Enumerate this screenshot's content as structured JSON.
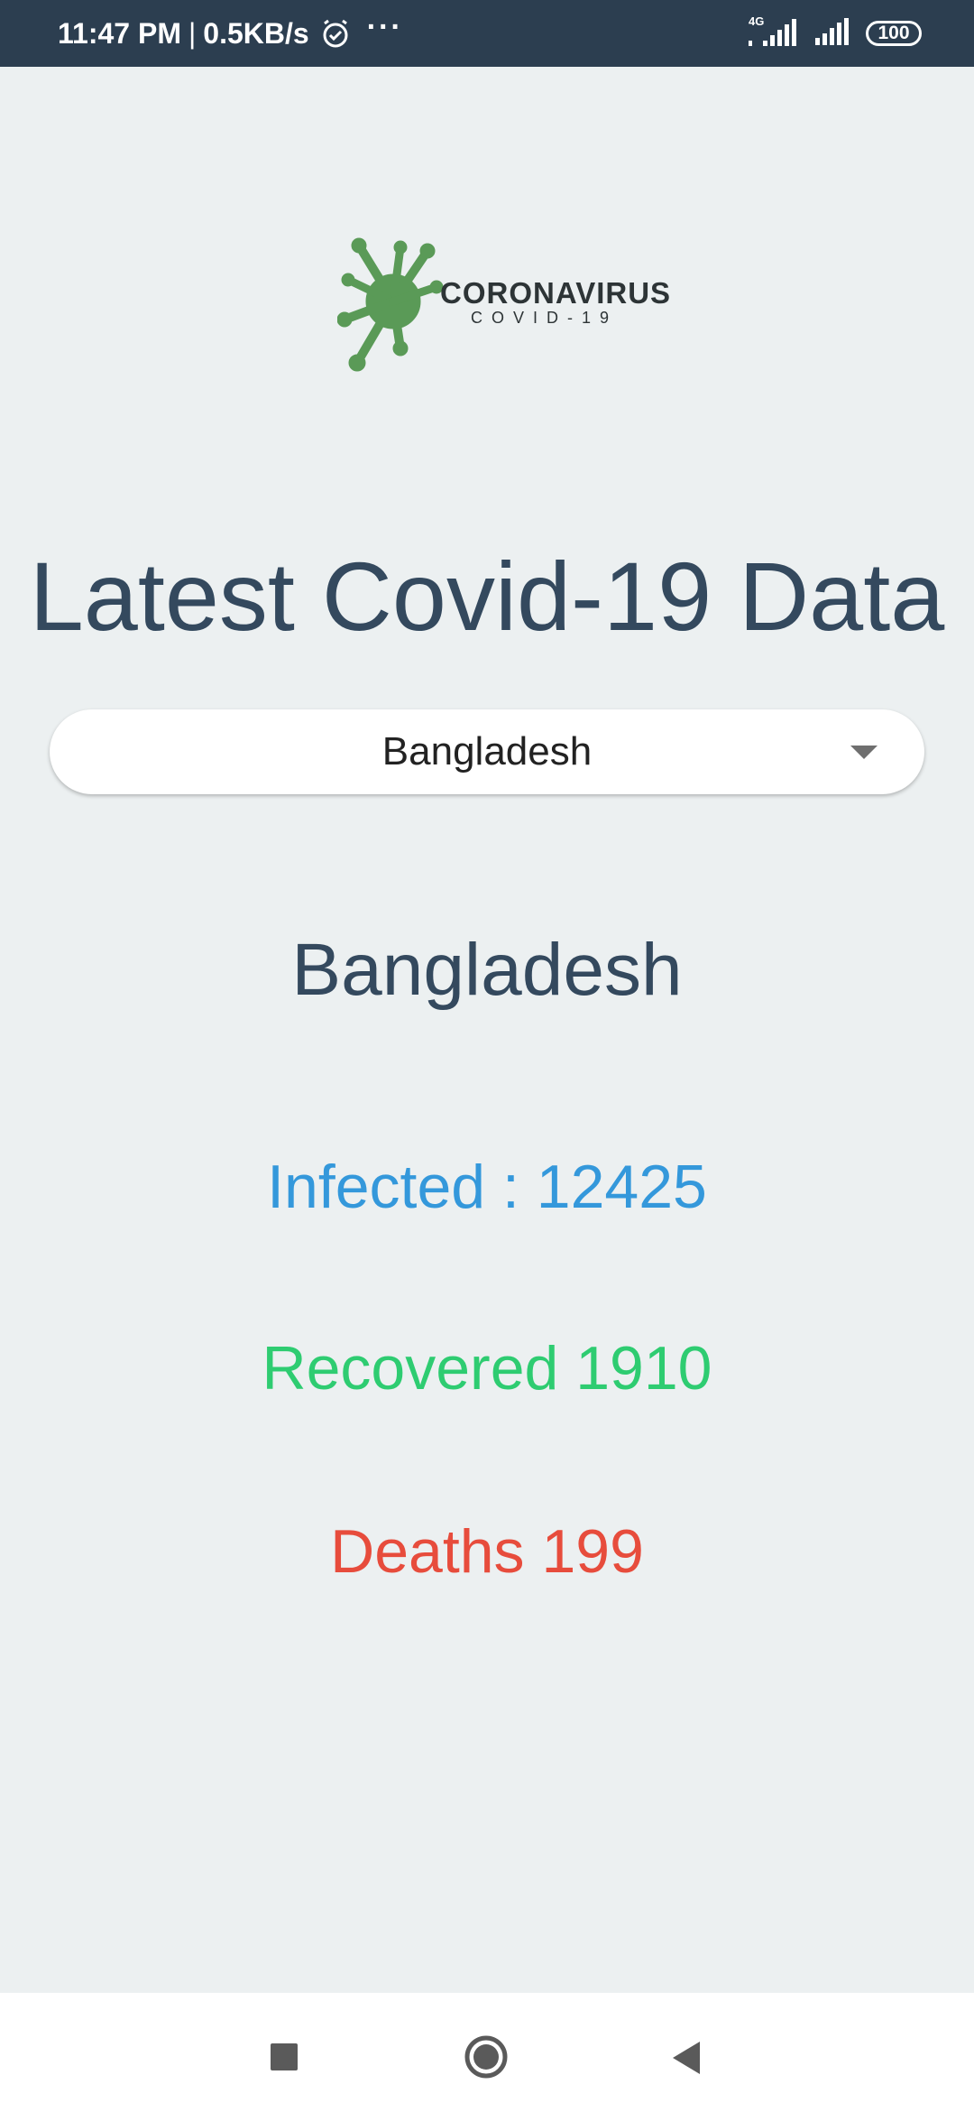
{
  "status_bar": {
    "time": "11:47 PM",
    "separator": "|",
    "net_speed": "0.5KB/s",
    "dots": "···",
    "network": "4G",
    "battery": "100"
  },
  "logo": {
    "title": "CORONAVIRUS",
    "subtitle": "COVID-19",
    "color": "#5a9a57"
  },
  "page": {
    "title": "Latest Covid-19 Data"
  },
  "country_select": {
    "selected": "Bangladesh"
  },
  "summary": {
    "country": "Bangladesh",
    "infected": "Infected : 12425",
    "recovered": "Recovered 1910",
    "deaths": "Deaths 199"
  },
  "colors": {
    "header": "#2c3e50",
    "background": "#ecf0f1",
    "infected": "#3498db",
    "recovered": "#2ecc71",
    "deaths": "#e74c3c"
  },
  "nav": {
    "icons": [
      "recents-icon",
      "home-icon",
      "back-icon"
    ]
  }
}
